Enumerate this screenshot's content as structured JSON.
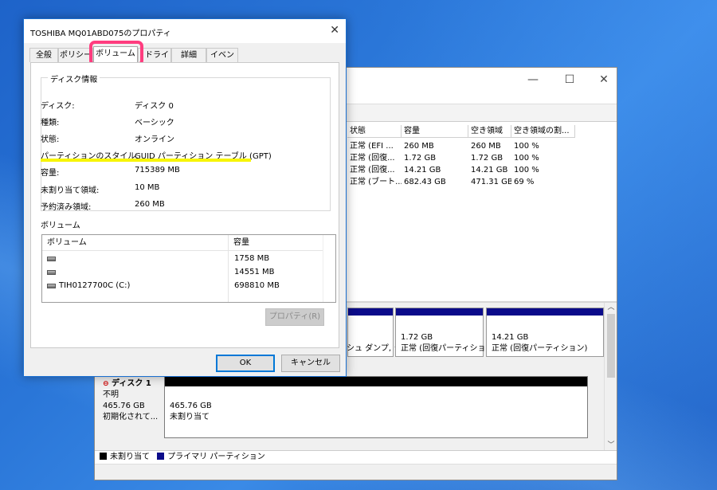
{
  "dialog": {
    "title": "TOSHIBA MQ01ABD075のプロパティ",
    "close_glyph": "✕",
    "tabs": [
      {
        "label": "全般"
      },
      {
        "label": "ポリシー"
      },
      {
        "label": "ボリューム"
      },
      {
        "label": "ドライバー"
      },
      {
        "label": "詳細"
      },
      {
        "label": "イベント"
      }
    ],
    "active_tab": "ボリューム",
    "disk_info_title": "ディスク情報",
    "disk_info": [
      {
        "label": "ディスク:",
        "value": "ディスク 0"
      },
      {
        "label": "種類:",
        "value": "ベーシック"
      },
      {
        "label": "状態:",
        "value": "オンライン"
      },
      {
        "label": "パーティションのスタイル:",
        "value": "GUID パーティション テーブル (GPT)"
      },
      {
        "label": "容量:",
        "value": "715389 MB"
      },
      {
        "label": "未割り当て領域:",
        "value": "10 MB"
      },
      {
        "label": "予約済み領域:",
        "value": "260 MB"
      }
    ],
    "volumes_title": "ボリューム",
    "volume_list": {
      "headers": [
        "ボリューム",
        "容量"
      ],
      "rows": [
        {
          "name": "",
          "size": "1758 MB"
        },
        {
          "name": "",
          "size": "14551 MB"
        },
        {
          "name": "TIH0127700C (C:)",
          "size": "698810 MB"
        }
      ]
    },
    "properties_button": "プロパティ(R)",
    "ok_button": "OK",
    "cancel_button": "キャンセル",
    "highlight_color": "#ff3d7f",
    "underline_color": "#f7f500"
  },
  "disk_management": {
    "window_controls": {
      "minimize": "—",
      "maximize": "☐",
      "close": "✕"
    },
    "columns": [
      "状態",
      "容量",
      "空き領域",
      "空き領域の割..."
    ],
    "rows": [
      [
        "正常 (EFI ...",
        "260 MB",
        "260 MB",
        "100 %"
      ],
      [
        "正常 (回復...",
        "1.72 GB",
        "1.72 GB",
        "100 %"
      ],
      [
        "正常 (回復...",
        "14.21 GB",
        "14.21 GB",
        "100 %"
      ],
      [
        "正常 (ブート...",
        "682.43 GB",
        "471.31 GB",
        "69 %"
      ]
    ],
    "disk0_partitions": [
      {
        "size": "",
        "status": "シュ ダンプ, ^"
      },
      {
        "size": "1.72 GB",
        "status": "正常 (回復パーティション"
      },
      {
        "size": "14.21 GB",
        "status": "正常 (回復パーティション)"
      }
    ],
    "disk1": {
      "name": "ディスク 1",
      "type": "不明",
      "size": "465.76 GB",
      "state": "初期化されて...",
      "partition_size": "465.76 GB",
      "partition_status": "未割り当て"
    },
    "legend": [
      {
        "label": "未割り当て",
        "color": "#000000"
      },
      {
        "label": "プライマリ パーティション",
        "color": "#0b0b8a"
      }
    ]
  }
}
